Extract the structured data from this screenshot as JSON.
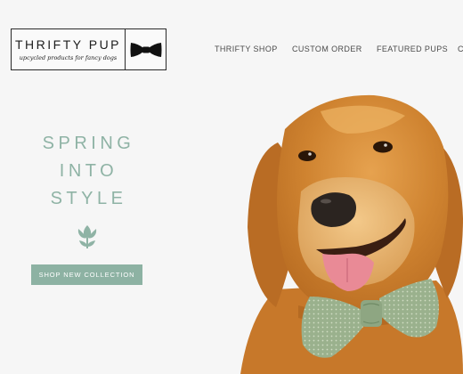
{
  "brand": {
    "name": "THRIFTY PUP",
    "tagline": "upcycled products for fancy dogs"
  },
  "nav": {
    "items": [
      {
        "label": "THRIFTY SHOP"
      },
      {
        "label": "CUSTOM ORDER"
      },
      {
        "label": "FEATURED PUPS"
      },
      {
        "label": "C"
      }
    ]
  },
  "hero": {
    "lines": [
      "SPRING",
      "INTO",
      "STYLE"
    ],
    "cta_label": "SHOP NEW COLLECTION"
  },
  "icons": {
    "logo_icon": "bow-tie-icon",
    "hero_icon": "tulip-icon"
  },
  "colors": {
    "accent": "#8fb3a5",
    "background": "#f6f6f6",
    "text": "#4b4b4b"
  }
}
